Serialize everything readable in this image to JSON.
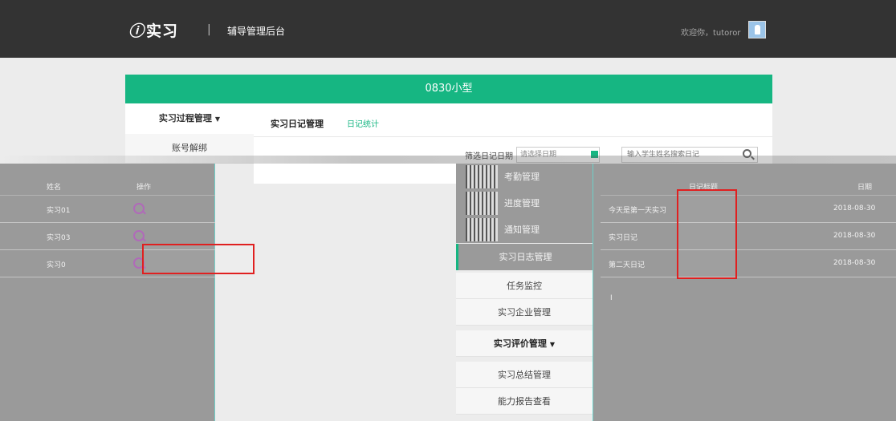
{
  "header": {
    "logo_text": "实习",
    "separator": "|",
    "admin_title": "辅导管理后台",
    "welcome": "欢迎你，tutoror"
  },
  "course": {
    "name": "0830小型"
  },
  "sidebar": {
    "section_title": "实习过程管理",
    "account_unbind": "账号解绑"
  },
  "tabs": {
    "journal_manage": "实习日记管理",
    "journal_stats": "日记统计"
  },
  "filters": {
    "date_label": "筛选日记日期",
    "date_placeholder": "请选择日期",
    "search_placeholder": "输入学生姓名搜索日记"
  },
  "left_table": {
    "headers": [
      "姓名",
      "操作"
    ],
    "rows": [
      {
        "name": "实习01"
      },
      {
        "name": "实习03"
      },
      {
        "name": "实习0"
      }
    ]
  },
  "mid_menu": {
    "dark_items": [
      "考勤管理",
      "进度管理",
      "通知管理"
    ],
    "active_item": "实习日志管理",
    "items": [
      "任务监控",
      "实习企业管理",
      "实习评价管理",
      "实习总结管理",
      "能力报告查看"
    ]
  },
  "right_table": {
    "headers": [
      "日记标题",
      "日期"
    ],
    "rows": [
      {
        "title": "今天是第一天实习",
        "date": "2018-08-30"
      },
      {
        "title": "实习日记",
        "date": "2018-08-30"
      },
      {
        "title": "第二天日记",
        "date": "2018-08-30"
      }
    ],
    "cursor": "I"
  },
  "colors": {
    "brand_green": "#16b682",
    "topbar": "#333333",
    "highlight_red": "#e02020"
  }
}
